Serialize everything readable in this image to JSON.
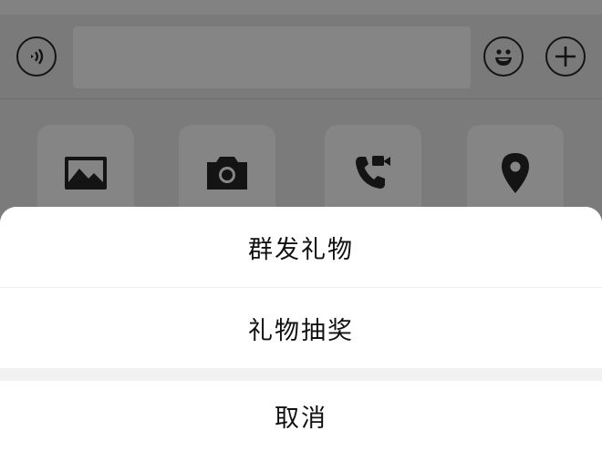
{
  "input_bar": {
    "voice_icon": "voice-wave-icon",
    "emoji_icon": "smiley-icon",
    "plus_icon": "plus-circle-icon",
    "message_value": ""
  },
  "tools": [
    {
      "icon": "image-icon"
    },
    {
      "icon": "camera-icon"
    },
    {
      "icon": "video-call-icon"
    },
    {
      "icon": "location-pin-icon"
    }
  ],
  "action_sheet": {
    "items": [
      {
        "label": "群发礼物"
      },
      {
        "label": "礼物抽奖"
      }
    ],
    "cancel_label": "取消"
  },
  "colors": {
    "overlay_gray": "#7d7d7d",
    "sheet_background": "#ffffff",
    "sheet_separator": "#f1f1f1",
    "icon_dark": "#141414"
  }
}
